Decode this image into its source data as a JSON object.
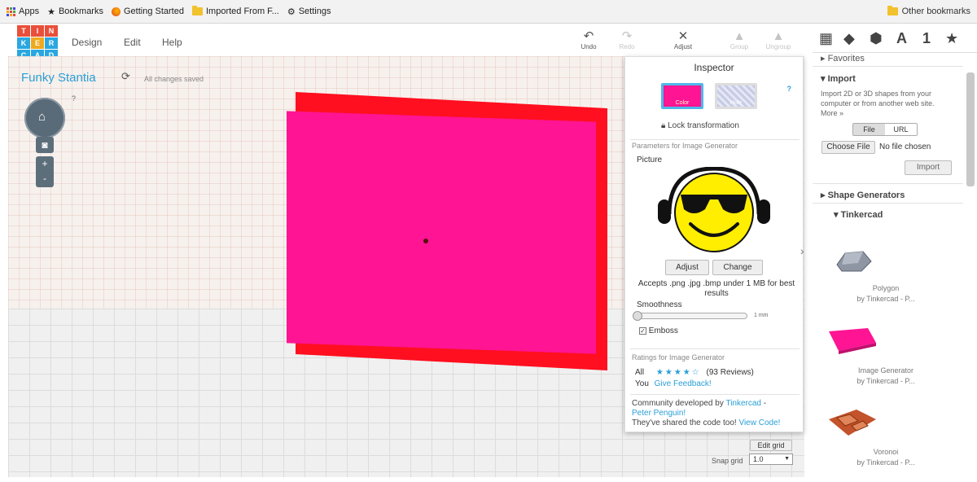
{
  "bookmarks": {
    "apps": "Apps",
    "items": [
      {
        "label": "Bookmarks",
        "icon": "star-icon"
      },
      {
        "label": "Getting Started",
        "icon": "firefox-icon"
      },
      {
        "label": "Imported From F...",
        "icon": "folder-icon"
      },
      {
        "label": "Settings",
        "icon": "gear-icon"
      }
    ],
    "other": "Other bookmarks"
  },
  "logo": [
    "T",
    "I",
    "N",
    "K",
    "E",
    "R",
    "C",
    "A",
    "D"
  ],
  "menu": {
    "design": "Design",
    "edit": "Edit",
    "help": "Help"
  },
  "toolbar": {
    "undo": "Undo",
    "redo": "Redo",
    "adjust": "Adjust",
    "group": "Group",
    "ungroup": "Ungroup"
  },
  "project": {
    "title": "Funky Stantia",
    "status": "All changes saved"
  },
  "nav": {
    "help": "?",
    "plus": "+",
    "minus": "-"
  },
  "inspector": {
    "title": "Inspector",
    "help": "?",
    "color_label": "Color",
    "hole_label": "Hole",
    "lock": "Lock transformation",
    "params_title": "Parameters for Image Generator",
    "picture_label": "Picture",
    "adjust": "Adjust",
    "change": "Change",
    "accepts": "Accepts .png .jpg .bmp under 1 MB for best results",
    "smoothness": "Smoothness",
    "smooth_value": "1 mm",
    "emboss": "Emboss",
    "ratings_title": "Ratings for Image Generator",
    "all": "All",
    "reviews": "(93 Reviews)",
    "rating": 4,
    "you": "You",
    "feedback": "Give Feedback!",
    "community": "Community developed by",
    "author1": "Tinkercad",
    "author2": "Peter Penguin!",
    "shared": "They've shared the code too!",
    "view_code": "View Code!"
  },
  "grid": {
    "edit": "Edit grid",
    "snap": "Snap grid",
    "snap_value": "1.0"
  },
  "right": {
    "tools": [
      "grid-icon",
      "cube-icon",
      "shape-icon",
      "A",
      "1",
      "★"
    ],
    "favorites": "Favorites",
    "import": "Import",
    "import_desc": "Import 2D or 3D shapes from your computer or from another web site.",
    "more": "More »",
    "file_tab": "File",
    "url_tab": "URL",
    "choose": "Choose File",
    "no_file": "No file chosen",
    "import_btn": "Import",
    "shape_gen": "Shape Generators",
    "tinkercad": "Tinkercad",
    "items": [
      {
        "name": "Polygon",
        "by": "by Tinkercad - P..."
      },
      {
        "name": "Image Generator",
        "by": "by Tinkercad - P..."
      },
      {
        "name": "Voronoi",
        "by": "by Tinkercad - P..."
      }
    ]
  },
  "colors": {
    "accent": "#2a9fd6",
    "pink": "#ff1493",
    "red": "#ff0f1f"
  }
}
